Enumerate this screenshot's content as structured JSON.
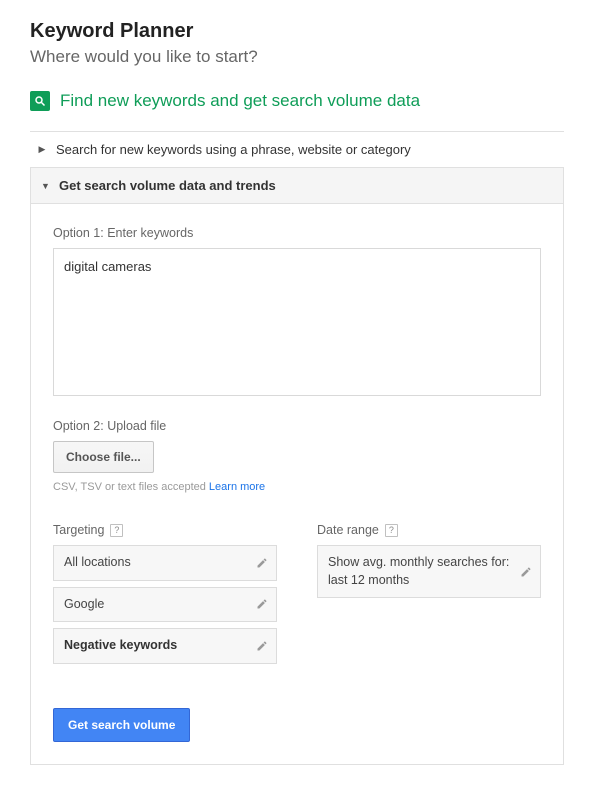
{
  "header": {
    "title": "Keyword Planner",
    "subtitle": "Where would you like to start?"
  },
  "section": {
    "heading": "Find new keywords and get search volume data"
  },
  "accordion": {
    "collapsed_label": "Search for new keywords using a phrase, website or category",
    "expanded_label": "Get search volume data and trends"
  },
  "panel": {
    "option1_label": "Option 1: Enter keywords",
    "keywords_value": "digital cameras",
    "option2_label": "Option 2: Upload file",
    "choose_file_label": "Choose file...",
    "file_help_text": "CSV, TSV or text files accepted ",
    "file_help_link": "Learn more"
  },
  "targeting": {
    "label": "Targeting",
    "items": [
      "All locations",
      "Google",
      "Negative keywords"
    ]
  },
  "date_range": {
    "label": "Date range",
    "value": "Show avg. monthly searches for: last 12 months"
  },
  "submit": {
    "label": "Get search volume"
  }
}
